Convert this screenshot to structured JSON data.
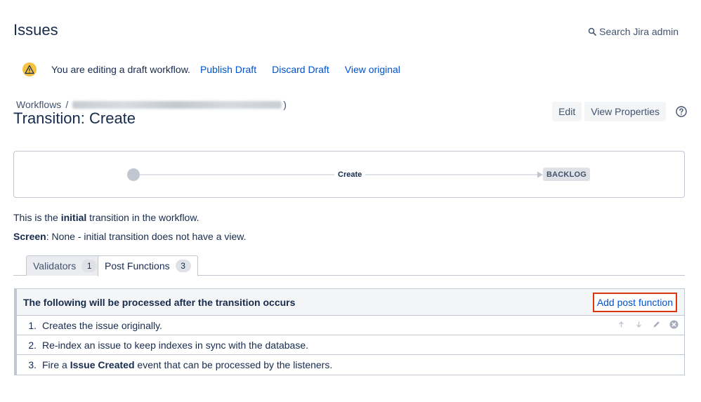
{
  "header": {
    "title": "Issues",
    "search_label": "Search Jira admin"
  },
  "draft_banner": {
    "message": "You are editing a draft workflow.",
    "publish_label": "Publish Draft",
    "discard_label": "Discard Draft",
    "view_original_label": "View original"
  },
  "breadcrumb": {
    "root": "Workflows",
    "separator": "/",
    "suffix": ")"
  },
  "transition": {
    "title": "Transition: Create",
    "edit_label": "Edit",
    "view_properties_label": "View Properties"
  },
  "diagram": {
    "transition_name": "Create",
    "target_status": "BACKLOG"
  },
  "info": {
    "line1_prefix": "This is the ",
    "line1_bold": "initial",
    "line1_suffix": " transition in the workflow.",
    "line2_bold": "Screen",
    "line2_rest": ": None - initial transition does not have a view."
  },
  "tabs": [
    {
      "label": "Validators",
      "count": "1",
      "active": false
    },
    {
      "label": "Post Functions",
      "count": "3",
      "active": true
    }
  ],
  "post_functions": {
    "header": "The following will be processed after the transition occurs",
    "add_label": "Add post function",
    "rows": [
      {
        "num": "1.",
        "text": "Creates the issue originally."
      },
      {
        "num": "2.",
        "text": "Re-index an issue to keep indexes in sync with the database."
      },
      {
        "num": "3.",
        "text_prefix": "Fire a ",
        "text_bold": "Issue Created",
        "text_suffix": " event that can be processed by the listeners."
      }
    ]
  },
  "colors": {
    "link": "#0052cc",
    "highlight_border": "#de350b",
    "warning": "#f5c242"
  }
}
